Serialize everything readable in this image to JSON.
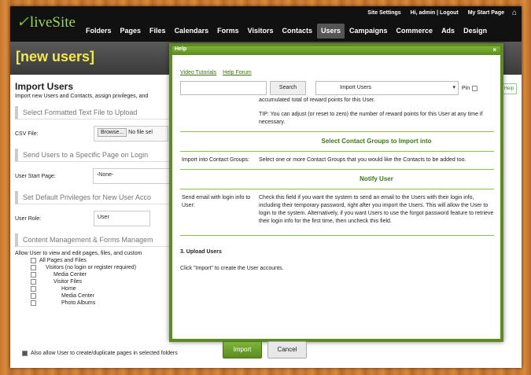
{
  "app": {
    "logo": "liveSite"
  },
  "util": {
    "settings": "Site Settings",
    "greeting": "Hi, admin",
    "logout": "Logout",
    "start": "My Start Page"
  },
  "nav": [
    "Folders",
    "Pages",
    "Files",
    "Calendars",
    "Forms",
    "Visitors",
    "Contacts",
    "Users",
    "Campaigns",
    "Commerce",
    "Ads",
    "Design"
  ],
  "banner": {
    "title": "[new users]"
  },
  "page": {
    "heading": "Import Users",
    "sub": "Import new Users and Contacts, assign privileges, and",
    "s1": "Select Formatted Text File to Upload",
    "csv_label": "CSV File:",
    "browse": "Browse...",
    "nofile": "No file sel",
    "s2": "Send Users to a Specific Page on Login",
    "start_label": "User Start Page:",
    "start_val": "-None-",
    "s3": "Set Default Privileges for New User Acco",
    "role_label": "User Role:",
    "role_val": "User",
    "s4": "Content Management & Forms Managem",
    "allow": "Allow User to view and edit pages, files, and custom",
    "tree": [
      "All Pages and Files",
      "Visitors (no login or register required)",
      "Media Center",
      "Visitor Files",
      "Home",
      "Media Center",
      "Photo Albums"
    ],
    "also": "Also allow User to create/duplicate pages in selected folders",
    "help": "Help"
  },
  "dialog": {
    "title": "Help",
    "close": "×",
    "link1": "Video Tutorials",
    "link2": "Help Forum",
    "search_btn": "Search",
    "select_val": "Import Users",
    "pin": "Pin",
    "text1": "accumulated total of reward points for this User.",
    "tip": "TIP: You can adjust (or reset to zero) the number of reward points for this User at any time if necessary.",
    "h1": "Select Contact Groups to Import into",
    "r1a": "Import into Contact Groups:",
    "r1b": "Select one or more Contact Groups that you would like the Contacts to be added too.",
    "h2": "Notify User",
    "r2a": "Send email with login info to User:",
    "r2b": "Check this field if you want the system to send an email to the Users with their login info, including their temporary password, right after you import the Users. This will allow the User to login to the system. Alternatively, if you want Users to use the forgot password feature to retrieve their login info for the first time, then uncheck this field.",
    "step3": "3. Upload Users",
    "step3b": "Click \"Import\" to create the User accounts."
  },
  "buttons": {
    "import": "Import",
    "cancel": "Cancel"
  }
}
